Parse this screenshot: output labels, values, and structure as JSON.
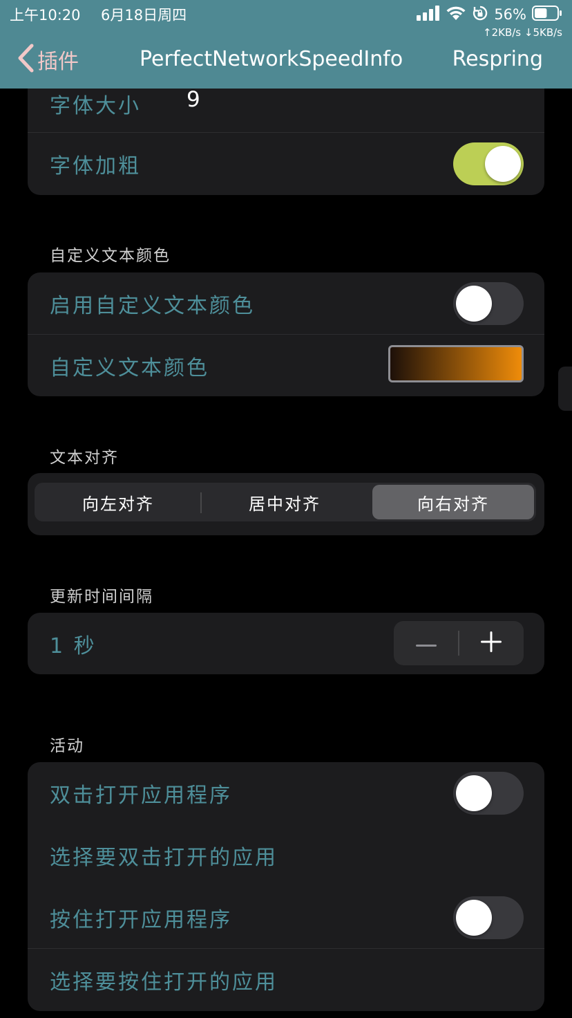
{
  "status_bar": {
    "time": "上午10:20",
    "date": "6月18日周四",
    "battery_percent": "56%",
    "network_speed": "↑2KB/s ↓5KB/s",
    "battery_level": 0.56
  },
  "nav": {
    "back_label": "插件",
    "title": "PerfectNetworkSpeedInfo",
    "action_label": "Respring"
  },
  "font_group": {
    "font_size_label": "字体大小",
    "font_size_value": "9",
    "bold_label": "字体加粗",
    "bold_enabled": true
  },
  "custom_color": {
    "section_title": "自定义文本颜色",
    "enable_label": "启用自定义文本颜色",
    "enable_enabled": false,
    "color_label": "自定义文本颜色",
    "gradient_colors": [
      "#1d1009",
      "#ef8c0a"
    ]
  },
  "alignment": {
    "section_title": "文本对齐",
    "options": [
      "向左对齐",
      "居中对齐",
      "向右对齐"
    ],
    "selected_index": 2
  },
  "update_interval": {
    "section_title": "更新时间间隔",
    "value": "1 秒"
  },
  "activity": {
    "section_title": "活动",
    "double_tap_label": "双击打开应用程序",
    "double_tap_enabled": false,
    "double_tap_app_label": "选择要双击打开的应用",
    "hold_label": "按住打开应用程序",
    "hold_enabled": false,
    "hold_app_label": "选择要按住打开的应用"
  },
  "colors": {
    "header_bg": "#4f8993",
    "label_teal": "#4e8f9a",
    "toggle_on": "#bccf55",
    "back_pink": "#f2c8c8"
  }
}
